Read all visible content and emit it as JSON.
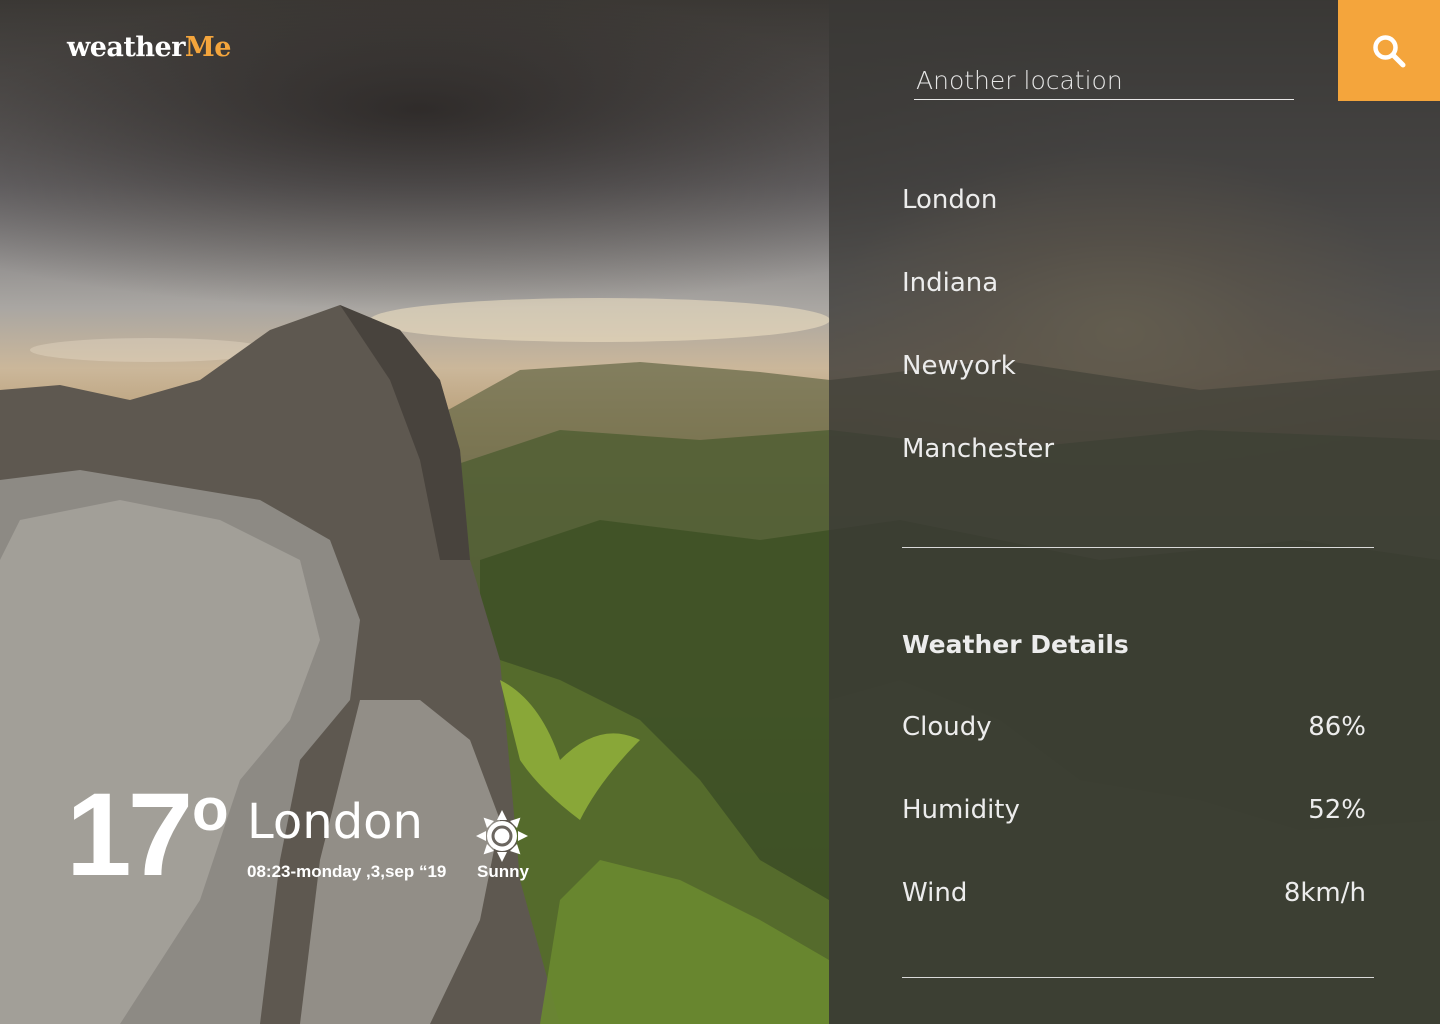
{
  "app": {
    "logo_main": "weather",
    "logo_accent": "Me"
  },
  "search": {
    "placeholder": "Another location",
    "button_icon": "search-icon"
  },
  "locations": [
    "London",
    "Indiana",
    "Newyork",
    "Manchester"
  ],
  "current": {
    "temperature": "17",
    "unit": "o",
    "city": "London",
    "datetime": "08:23-monday ,3,sep “19",
    "condition": "Sunny",
    "condition_icon": "sun-icon"
  },
  "details": {
    "title": "Weather Details",
    "rows": [
      {
        "label": "Cloudy",
        "value": "86%"
      },
      {
        "label": "Humidity",
        "value": "52%"
      },
      {
        "label": "Wind",
        "value": "8km/h"
      }
    ]
  },
  "colors": {
    "accent": "#f4a53c",
    "panel": "#3a3836"
  }
}
